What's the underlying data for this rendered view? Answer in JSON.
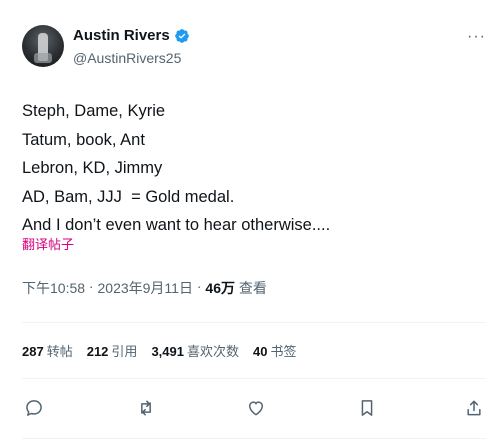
{
  "author": {
    "display_name": "Austin Rivers",
    "handle": "@AustinRivers25",
    "verified_icon": "verified-badge-icon"
  },
  "tweet": {
    "lines": [
      "Steph, Dame, Kyrie",
      "Tatum, book, Ant",
      "Lebron, KD, Jimmy",
      "AD, Bam, JJJ  = Gold medal.",
      "And I don’t even want to hear otherwise...."
    ],
    "translate_label": "翻译帖子"
  },
  "meta": {
    "time": "下午10:58",
    "sep1": " · ",
    "date": "2023年9月11日",
    "sep2": " · ",
    "views_count": "46万",
    "views_label": " 查看"
  },
  "stats": [
    {
      "value": "287",
      "label": "转帖"
    },
    {
      "value": "212",
      "label": "引用"
    },
    {
      "value": "3,491",
      "label": "喜欢次数"
    },
    {
      "value": "40",
      "label": "书签"
    }
  ],
  "colors": {
    "text": "#0f1419",
    "secondary": "#536471",
    "verified": "#1d9bf0",
    "translate": "#d6007f"
  },
  "actions": [
    "reply-icon",
    "retweet-icon",
    "like-icon",
    "bookmark-icon",
    "share-icon"
  ]
}
